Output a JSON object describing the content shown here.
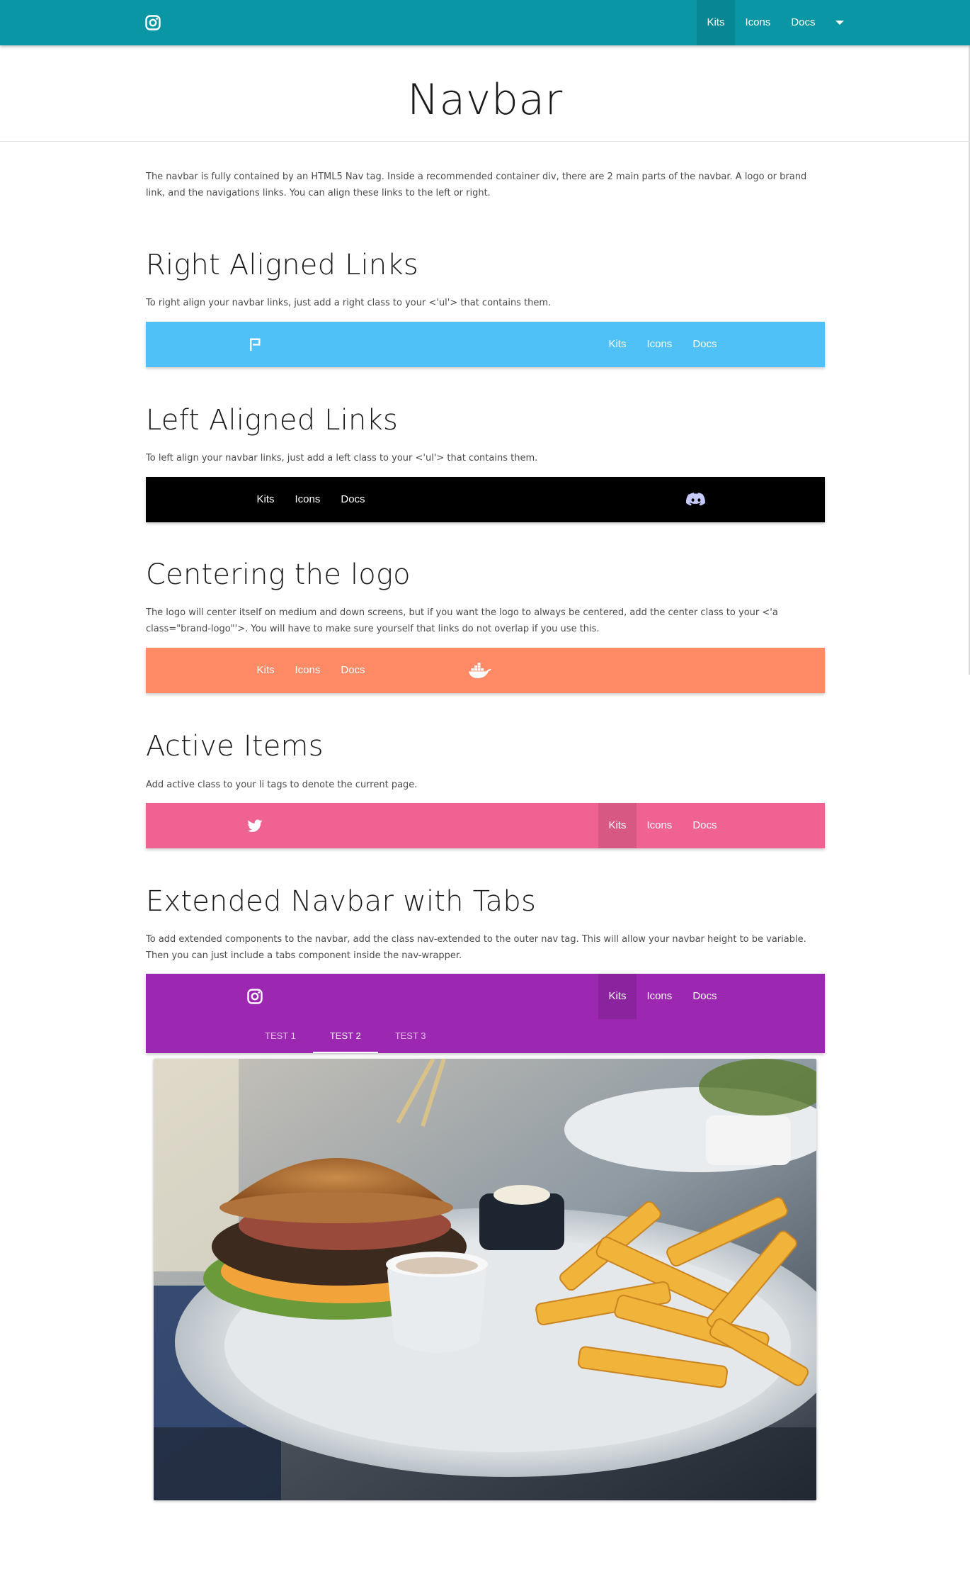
{
  "topnav": {
    "brand_icon": "instagram-icon",
    "links": [
      "Kits",
      "Icons",
      "Docs"
    ],
    "active_index": 0,
    "dropdown_icon": "arrow-drop-down-icon",
    "color": "#0a96a4"
  },
  "header": {
    "title": "Navbar"
  },
  "intro": "The navbar is fully contained by an HTML5 Nav tag. Inside a recommended container div, there are 2 main parts of the navbar. A logo or brand link, and the navigations links. You can align these links to the left or right.",
  "sections": {
    "right": {
      "title": "Right Aligned Links",
      "description": "To right align your navbar links, just add a right class to your <'ul'> that contains them.",
      "nav": {
        "color": "#4fc1f6",
        "logo_icon": "flag-icon",
        "links": [
          "Kits",
          "Icons",
          "Docs"
        ]
      }
    },
    "left": {
      "title": "Left Aligned Links",
      "description": "To left align your navbar links, just add a left class to your <'ul'> that contains them.",
      "nav": {
        "color": "#000000",
        "logo_icon": "discord-icon",
        "links": [
          "Kits",
          "Icons",
          "Docs"
        ]
      }
    },
    "center": {
      "title": "Centering the logo",
      "description": "The logo will center itself on medium and down screens, but if you want the logo to always be centered, add the center class to your <'a class=\"brand-logo\"'>. You will have to make sure yourself that links do not overlap if you use this.",
      "nav": {
        "color": "#ff8a65",
        "logo_icon": "docker-icon",
        "links": [
          "Kits",
          "Icons",
          "Docs"
        ]
      }
    },
    "active": {
      "title": "Active Items",
      "description": "Add active class to your li tags to denote the current page.",
      "nav": {
        "color": "#f06292",
        "logo_icon": "twitter-icon",
        "links": [
          "Kits",
          "Icons",
          "Docs"
        ],
        "active_index": 0
      }
    },
    "extended": {
      "title": "Extended Navbar with Tabs",
      "description": "To add extended components to the navbar, add the class nav-extended to the outer nav tag. This will allow your navbar height to be variable. Then you can just include a tabs component inside the nav-wrapper.",
      "nav": {
        "color": "#9c27b0",
        "logo_icon": "instagram-icon",
        "links": [
          "Kits",
          "Icons",
          "Docs"
        ],
        "active_index": 0,
        "tabs": [
          "TEST 1",
          "TEST 2",
          "TEST 3"
        ],
        "active_tab": 1
      }
    }
  },
  "image": {
    "subject": "burger-and-fries-photo"
  }
}
